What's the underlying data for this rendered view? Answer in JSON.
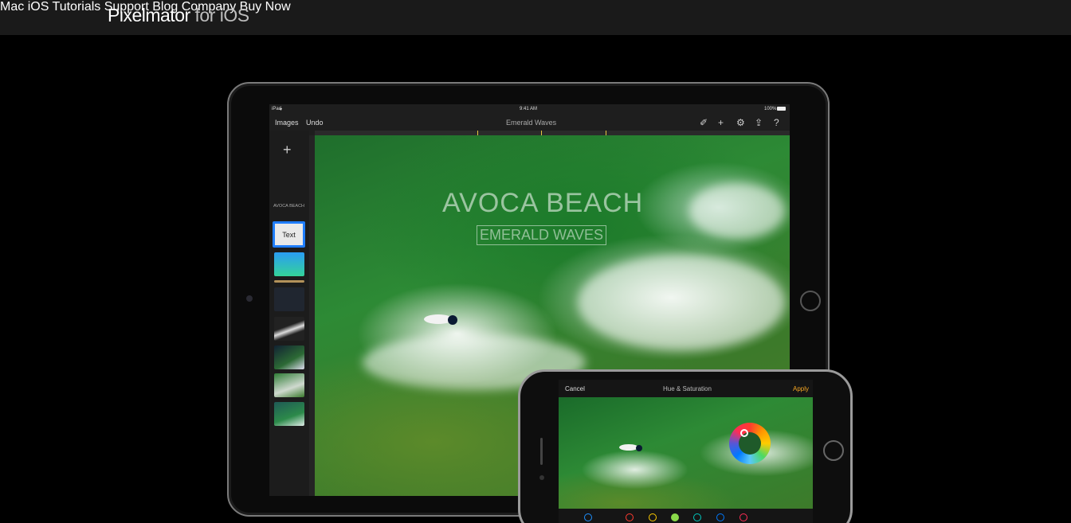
{
  "header": {
    "logo_brand": "Pixelmator",
    "logo_suffix": " for iOS",
    "nav": [
      "Mac",
      "iOS",
      "Tutorials",
      "Support",
      "Blog",
      "Company",
      "Buy Now"
    ]
  },
  "ipad": {
    "status": {
      "device": "iPad",
      "time": "9:41 AM",
      "battery": "100%"
    },
    "toolbar": {
      "images": "Images",
      "undo": "Undo",
      "doc_title": "Emerald Waves"
    },
    "sidebar": {
      "text_layer_caption": "AVOCA BEACH",
      "text_layer_label": "Text"
    },
    "canvas": {
      "headline": "AVOCA BEACH",
      "subheadline": "EMERALD WAVES"
    }
  },
  "iphone": {
    "cancel": "Cancel",
    "title": "Hue & Saturation",
    "apply": "Apply",
    "dot_colors": [
      "#1e90ff",
      "#ff3b30",
      "#ffcc00",
      "#8ad94a",
      "#00c7be",
      "#007aff",
      "#ff2d55"
    ]
  },
  "colors": {
    "apply_accent": "#f5a623",
    "selection": "#1f7dff"
  }
}
